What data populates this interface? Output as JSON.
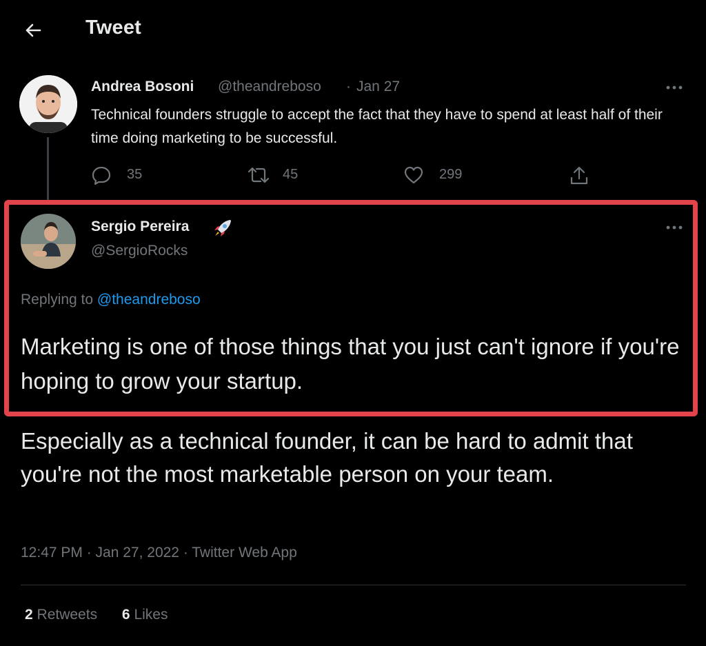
{
  "header": {
    "title": "Tweet"
  },
  "parent_tweet": {
    "name": "Andrea Bosoni",
    "handle": "@theandreboso",
    "separator": "·",
    "date": "Jan 27",
    "text": "Technical founders struggle to accept the fact that they have to spend at least half of their time doing marketing to be successful.",
    "replies": "35",
    "retweets": "45",
    "likes": "299"
  },
  "main_tweet": {
    "name": "Sergio Pereira",
    "name_emoji": "rocket",
    "handle": "@SergioRocks",
    "replying_prefix": "Replying to",
    "replying_handle": "@theandreboso",
    "text_part1": "Marketing is one of those things that you just can't ignore if you're hoping to grow your startup.",
    "text_part2": "Especially as a technical founder, it can be hard to admit that you're not the most marketable person on your team.",
    "timestamp": "12:47 PM · Jan 27, 2022 · Twitter Web App",
    "retweet_count": "2",
    "retweet_label": "Retweets",
    "like_count": "6",
    "like_label": "Likes"
  },
  "colors": {
    "background": "#000000",
    "text_primary": "#e7e9ea",
    "text_secondary": "#71767b",
    "link": "#1d9bf0",
    "highlight_border": "#e3444c"
  }
}
